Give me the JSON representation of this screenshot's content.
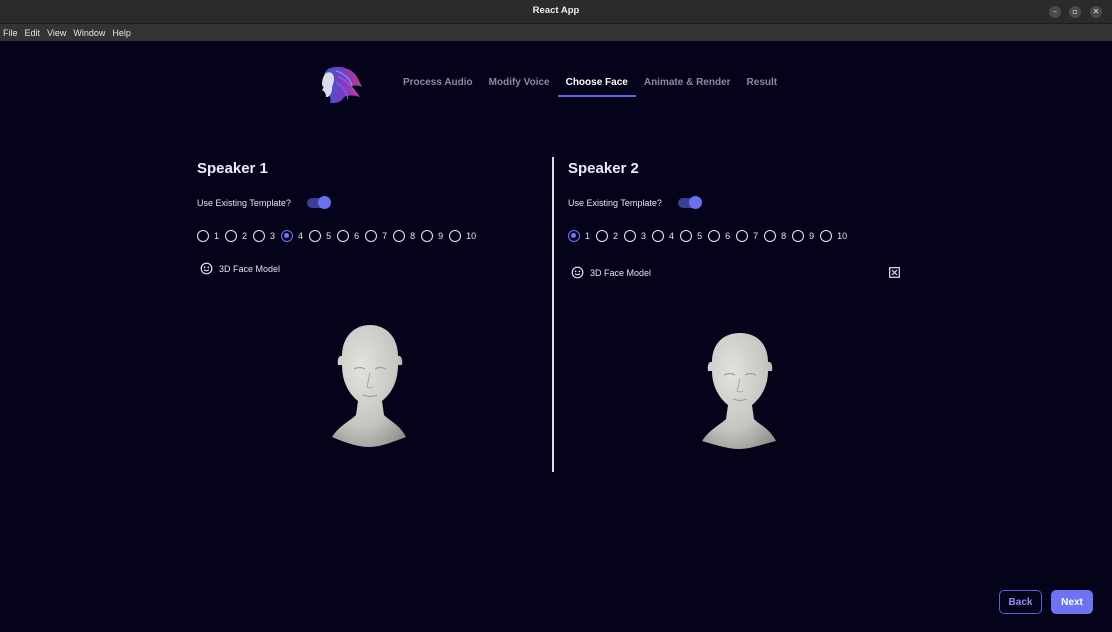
{
  "window": {
    "title": "React App"
  },
  "menu": {
    "items": [
      "File",
      "Edit",
      "View",
      "Window",
      "Help"
    ]
  },
  "steps": [
    {
      "label": "Process Audio",
      "active": false
    },
    {
      "label": "Modify Voice",
      "active": false
    },
    {
      "label": "Choose Face",
      "active": true
    },
    {
      "label": "Animate & Render",
      "active": false
    },
    {
      "label": "Result",
      "active": false
    }
  ],
  "speakers": [
    {
      "title": "Speaker 1",
      "template_label": "Use Existing Template?",
      "template_on": true,
      "options": [
        "1",
        "2",
        "3",
        "4",
        "5",
        "6",
        "7",
        "8",
        "9",
        "10"
      ],
      "selected": "4",
      "face_model_label": "3D Face Model"
    },
    {
      "title": "Speaker 2",
      "template_label": "Use Existing Template?",
      "template_on": true,
      "options": [
        "1",
        "2",
        "3",
        "4",
        "5",
        "6",
        "7",
        "8",
        "9",
        "10"
      ],
      "selected": "1",
      "face_model_label": "3D Face Model"
    }
  ],
  "footer": {
    "back_label": "Back",
    "next_label": "Next"
  },
  "colors": {
    "background": "#04031a",
    "accent": "#6e73f2",
    "toggle_track": "#3a3f96"
  }
}
